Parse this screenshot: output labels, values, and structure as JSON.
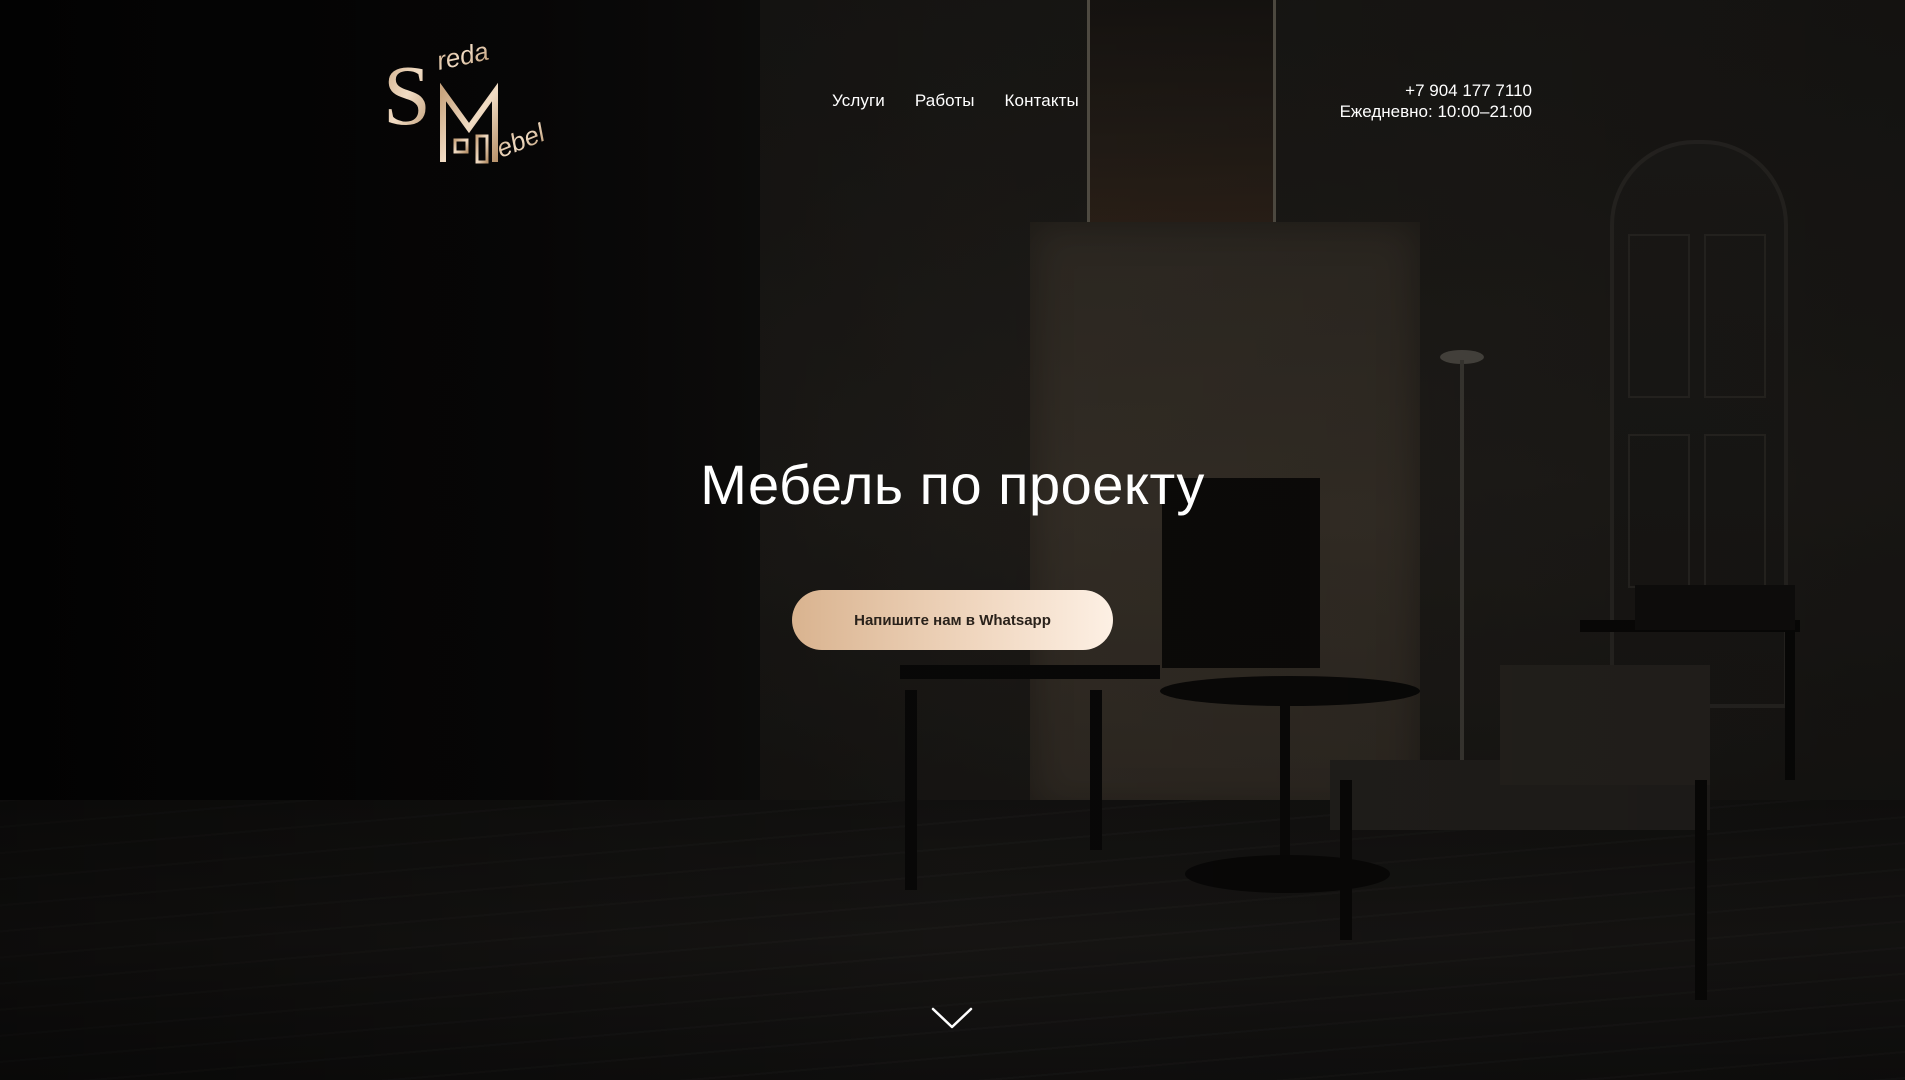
{
  "brand": {
    "logo_letters": "SM",
    "logo_word_top": "reda",
    "logo_word_bottom": "ebel",
    "logo_color": "#d9b38f"
  },
  "nav": {
    "items": [
      {
        "label": "Услуги"
      },
      {
        "label": "Работы"
      },
      {
        "label": "Контакты"
      }
    ]
  },
  "contact": {
    "phone": "+7 904 177 7110",
    "hours": "Ежедневно: 10:00–21:00"
  },
  "hero": {
    "title": "Мебель по проекту",
    "cta_label": "Напишите нам в Whatsapp",
    "cta_gradient": [
      "#d9b38f",
      "#fdf0e4"
    ],
    "scroll_icon": "chevron-down-icon"
  }
}
